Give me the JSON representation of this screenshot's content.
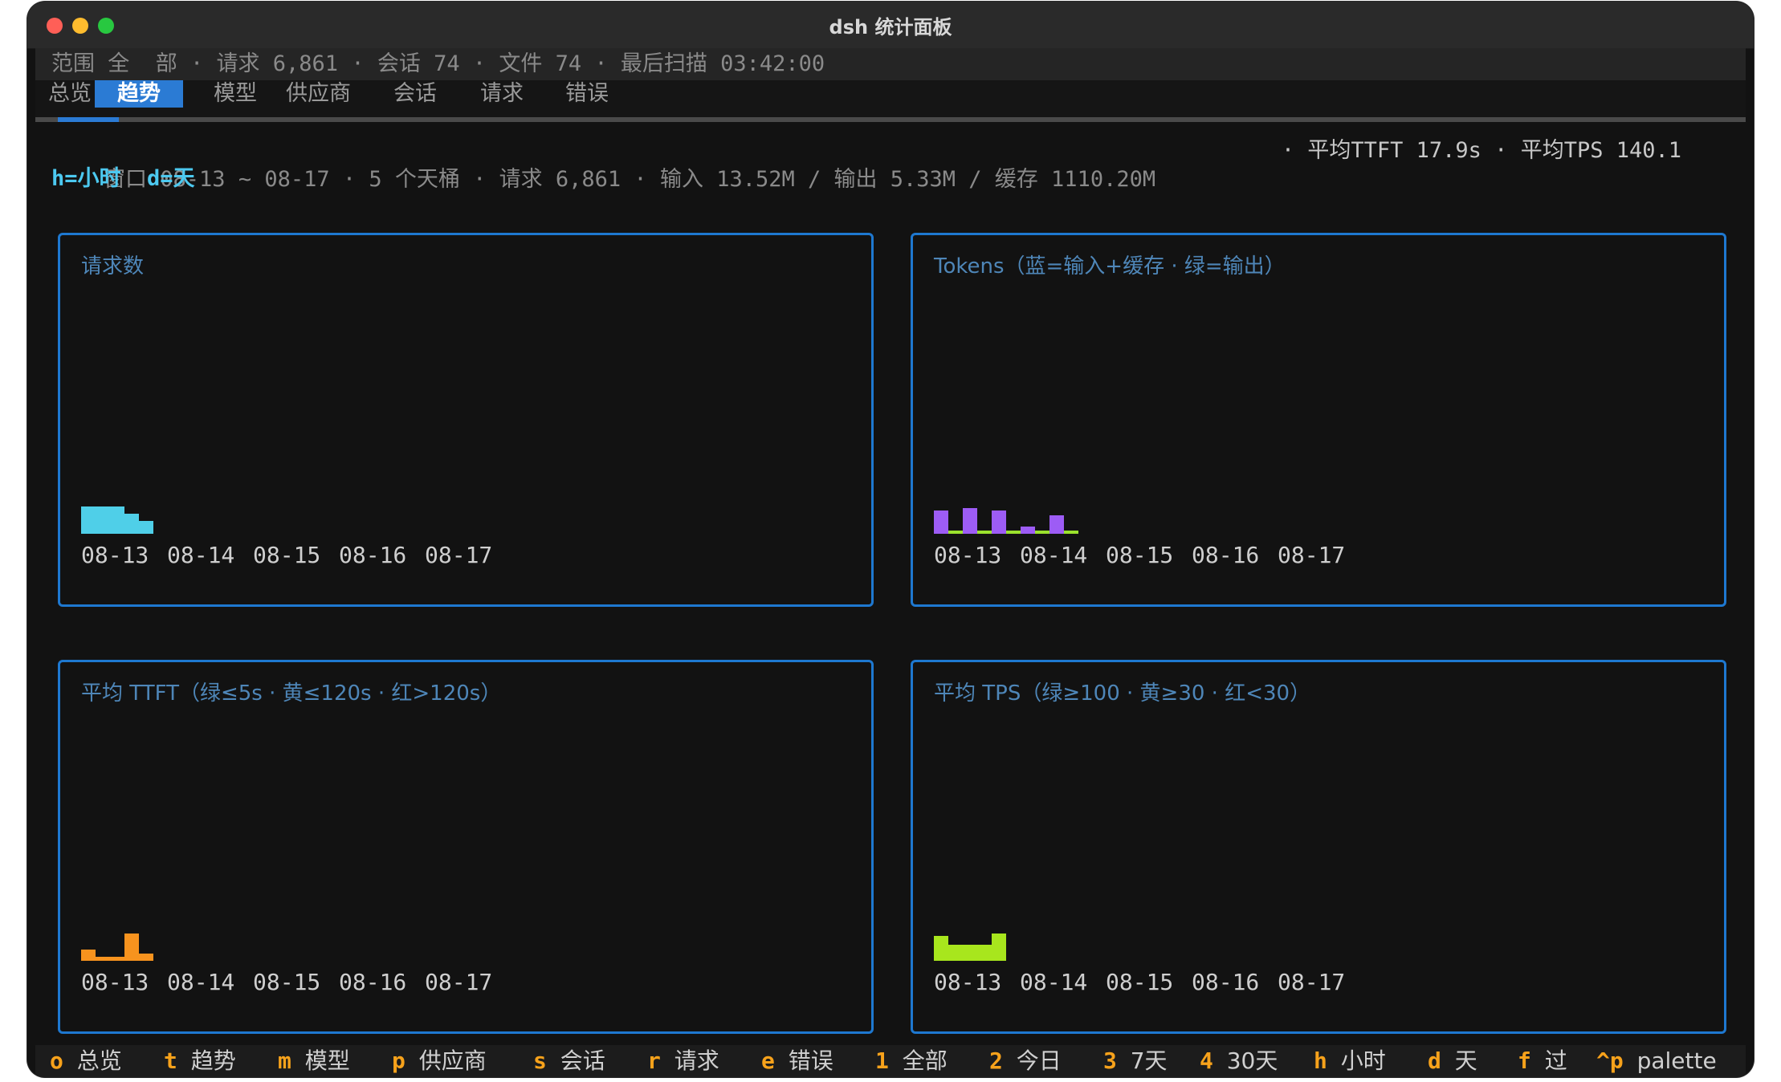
{
  "window": {
    "title": "dsh 统计面板"
  },
  "statusline": {
    "text": "范围 全  部 · 请求 6,861 · 会话 74 · 文件 74 · 最后扫描 03:42:00"
  },
  "tabs": [
    {
      "label": "总览",
      "active": false
    },
    {
      "label": "趋势",
      "active": true
    },
    {
      "label": "模型",
      "active": false
    },
    {
      "label": "供应商",
      "active": false
    },
    {
      "label": "会话",
      "active": false
    },
    {
      "label": "请求",
      "active": false
    },
    {
      "label": "错误",
      "active": false
    }
  ],
  "info": {
    "left": "窗口 08-13 ~ 08-17 · 5 个天桶 · 请求 6,861 · 输入 13.52M / 输出 5.33M / 缓存 1110.20M",
    "right": "· 平均TTFT 17.9s · 平均TPS 140.1"
  },
  "hints": {
    "text": "h=小时  d=天"
  },
  "colors": {
    "requests": "#4fcfe8",
    "tokens_input_cache": "#9d5cf5",
    "tokens_output": "#9be22d",
    "ttft": "#f7931e",
    "tps": "#a8e61d",
    "panel_border": "#1e78d0"
  },
  "chart_data": [
    {
      "type": "bar",
      "title": "请求数",
      "categories": [
        "08-13",
        "08-14",
        "08-15",
        "08-16",
        "08-17"
      ],
      "series": [
        {
          "values": [
            0.95,
            0.95,
            0.95,
            0.7,
            0.45
          ]
        }
      ],
      "color": "#4fcfe8"
    },
    {
      "type": "bar",
      "title": "Tokens（蓝=输入+缓存 · 绿=输出）",
      "categories": [
        "08-13",
        "08-14",
        "08-15",
        "08-16",
        "08-17"
      ],
      "series": [
        {
          "values": [
            0.8,
            0.9,
            0.8,
            0.25,
            0.65
          ]
        },
        {
          "values": [
            0.1,
            0.1,
            0.1,
            0.1,
            0.1
          ]
        }
      ],
      "colors": [
        "#9d5cf5",
        "#9be22d"
      ]
    },
    {
      "type": "bar",
      "title": "平均 TTFT（绿≤5s · 黄≤120s · 红>120s）",
      "categories": [
        "08-13",
        "08-14",
        "08-15",
        "08-16",
        "08-17"
      ],
      "series": [
        {
          "values": [
            0.4,
            0.15,
            0.15,
            0.95,
            0.25
          ]
        }
      ],
      "color": "#f7931e"
    },
    {
      "type": "bar",
      "title": "平均 TPS（绿≥100 · 黄≥30 · 红<30）",
      "categories": [
        "08-13",
        "08-14",
        "08-15",
        "08-16",
        "08-17"
      ],
      "series": [
        {
          "values": [
            0.85,
            0.55,
            0.55,
            0.55,
            0.95
          ]
        }
      ],
      "color": "#a8e61d"
    }
  ],
  "bottombar": [
    {
      "key": "o",
      "label": "总览"
    },
    {
      "key": "t",
      "label": "趋势"
    },
    {
      "key": "m",
      "label": "模型"
    },
    {
      "key": "p",
      "label": "供应商"
    },
    {
      "key": "s",
      "label": "会话"
    },
    {
      "key": "r",
      "label": "请求"
    },
    {
      "key": "e",
      "label": "错误"
    },
    {
      "key": "1",
      "label": "全部"
    },
    {
      "key": "2",
      "label": "今日"
    },
    {
      "key": "3",
      "label": "7天"
    },
    {
      "key": "4",
      "label": "30天"
    },
    {
      "key": "h",
      "label": "小时"
    },
    {
      "key": "d",
      "label": "天"
    },
    {
      "key": "f",
      "label": "过"
    },
    {
      "key": "^p",
      "label": "palette"
    }
  ]
}
